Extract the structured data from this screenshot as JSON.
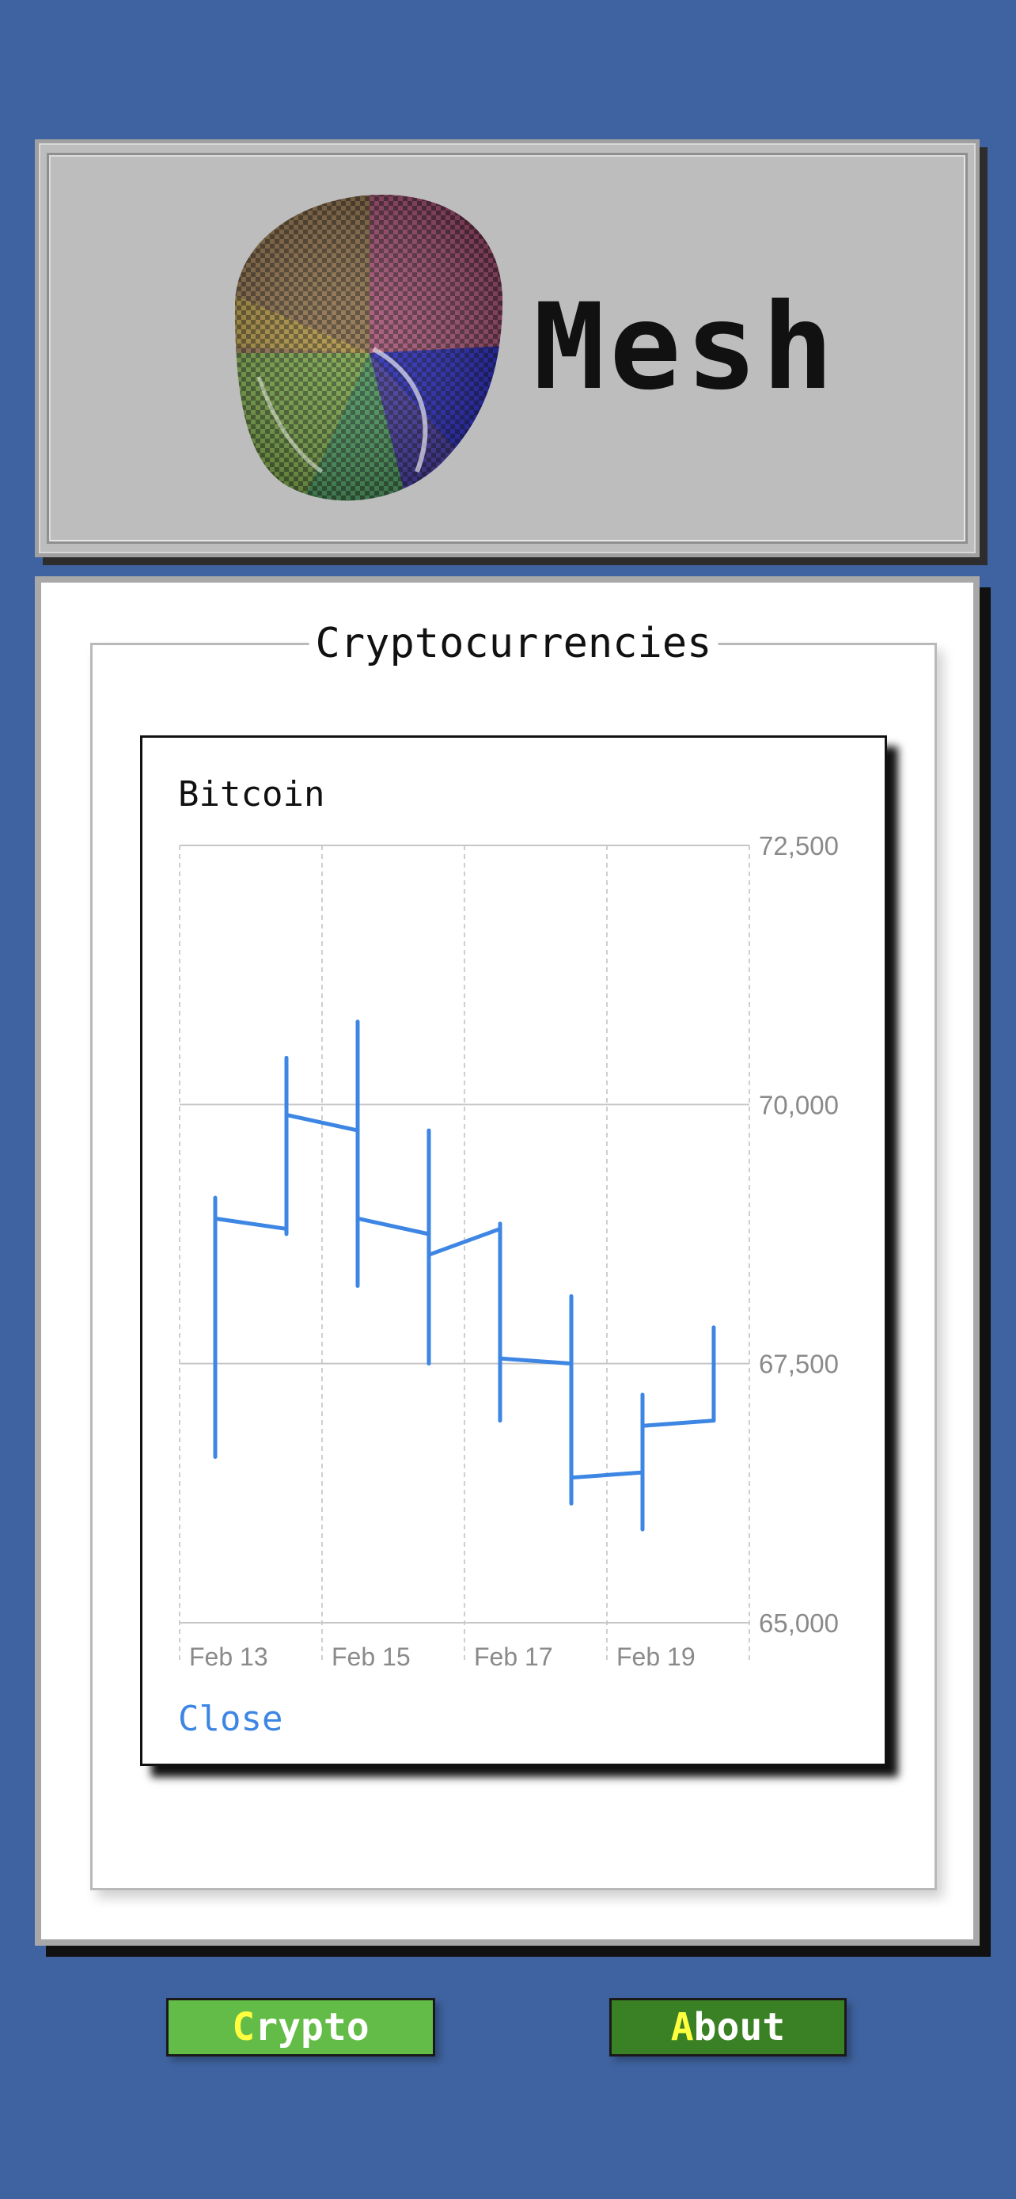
{
  "header": {
    "app_title": "Mesh",
    "logo_icon": "mesh-torus-logo-icon"
  },
  "main": {
    "section_title": "Cryptocurrencies",
    "chart_card": {
      "title": "Bitcoin",
      "close_label": "Close"
    }
  },
  "nav": {
    "crypto_first": "C",
    "crypto_rest": "rypto",
    "about_first": "A",
    "about_rest": "bout"
  },
  "colors": {
    "background": "#3f63a0",
    "series": "#3d86e3",
    "crypto_button": "#64bc48",
    "about_button": "#3a8024",
    "button_accent_letter": "#ffff40"
  },
  "chart_data": {
    "type": "ohlc",
    "title": "Bitcoin",
    "x_tick_labels": [
      "Feb 13",
      "Feb 15",
      "Feb 17",
      "Feb 19"
    ],
    "y_tick_labels": [
      "72,500",
      "70,000",
      "67,500",
      "65,000"
    ],
    "ylim": [
      65000,
      72500
    ],
    "y_ticks": [
      72500,
      70000,
      67500,
      65000
    ],
    "y_axis_position": "right",
    "grid": true,
    "series": [
      {
        "values": [
          {
            "x": "Feb 13",
            "open": 68900,
            "high": 69100,
            "low": 66600,
            "close": 68800
          },
          {
            "x": "Feb 14",
            "open": 69900,
            "high": 70450,
            "low": 68750,
            "close": 69750
          },
          {
            "x": "Feb 15",
            "open": 68900,
            "high": 70800,
            "low": 68250,
            "close": 68750
          },
          {
            "x": "Feb 16",
            "open": 68550,
            "high": 69750,
            "low": 67500,
            "close": 68800
          },
          {
            "x": "Feb 17",
            "open": 67550,
            "high": 68850,
            "low": 66950,
            "close": 67500
          },
          {
            "x": "Feb 18",
            "open": 66400,
            "high": 68150,
            "low": 66150,
            "close": 66450
          },
          {
            "x": "Feb 19",
            "open": 66900,
            "high": 67200,
            "low": 65900,
            "close": 66950
          }
        ]
      }
    ]
  }
}
